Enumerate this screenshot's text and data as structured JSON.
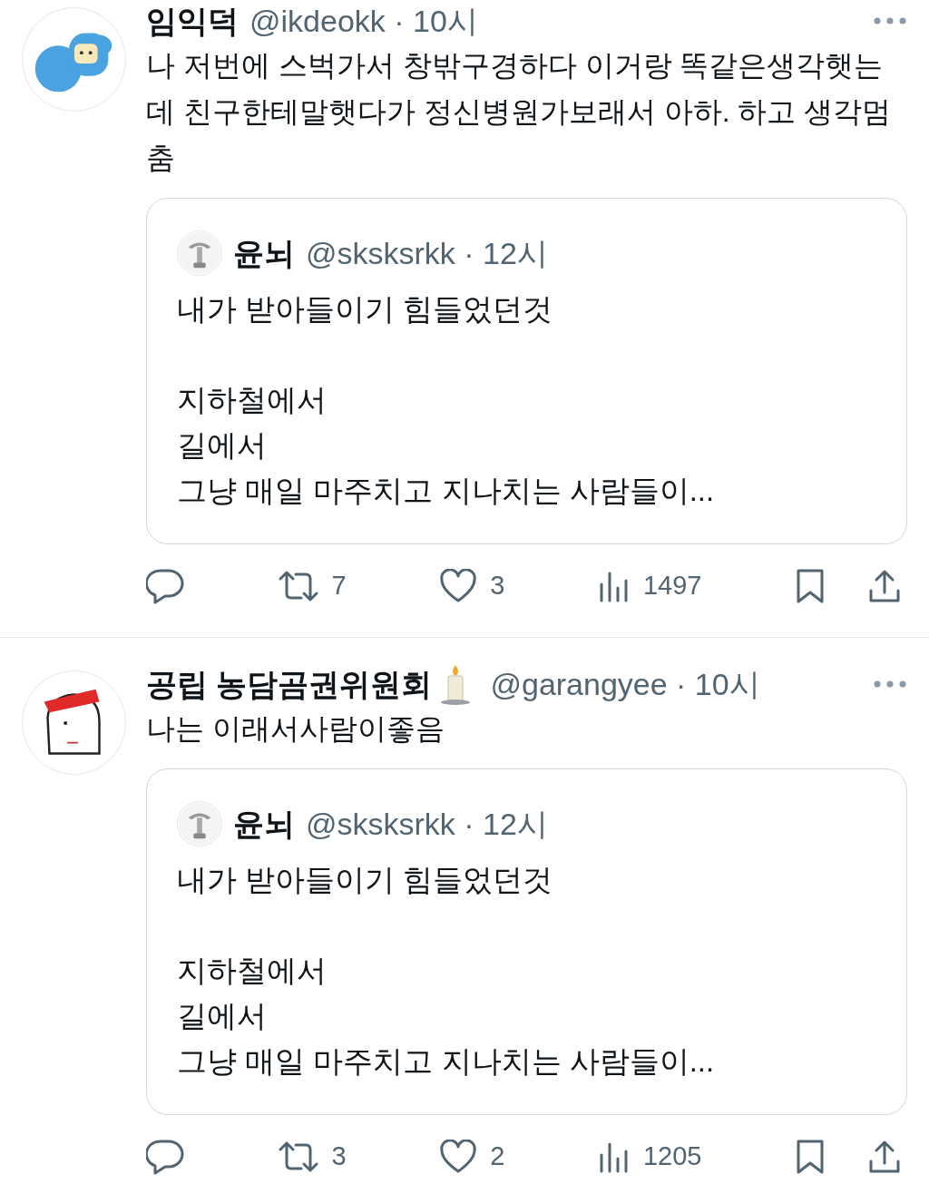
{
  "tweets": [
    {
      "name": "임익덕",
      "name_badge": false,
      "meta": "@ikdeokk · 10시",
      "text": "나 저번에 스벅가서 창밖구경하다 이거랑 똑같은생각햇는데 친구한테말햇다가 정신병원가보래서 아하. 하고 생각멈춤",
      "quote": {
        "name": "윤뇌",
        "meta": "@sksksrkk · 12시",
        "paragraphs": [
          "내가 받아들이기 힘들었던것",
          "지하철에서\n길에서\n그냥 매일 마주치고 지나치는 사람들이..."
        ]
      },
      "retweets": "7",
      "likes": "3",
      "views": "1497"
    },
    {
      "name": "공립 농담곰권위원회",
      "name_badge": true,
      "meta": "@garangyee · 10시",
      "text": "나는 이래서사람이좋음",
      "quote": {
        "name": "윤뇌",
        "meta": "@sksksrkk · 12시",
        "paragraphs": [
          "내가 받아들이기 힘들었던것",
          "지하철에서\n길에서\n그냥 매일 마주치고 지나치는 사람들이..."
        ]
      },
      "retweets": "3",
      "likes": "2",
      "views": "1205"
    }
  ]
}
